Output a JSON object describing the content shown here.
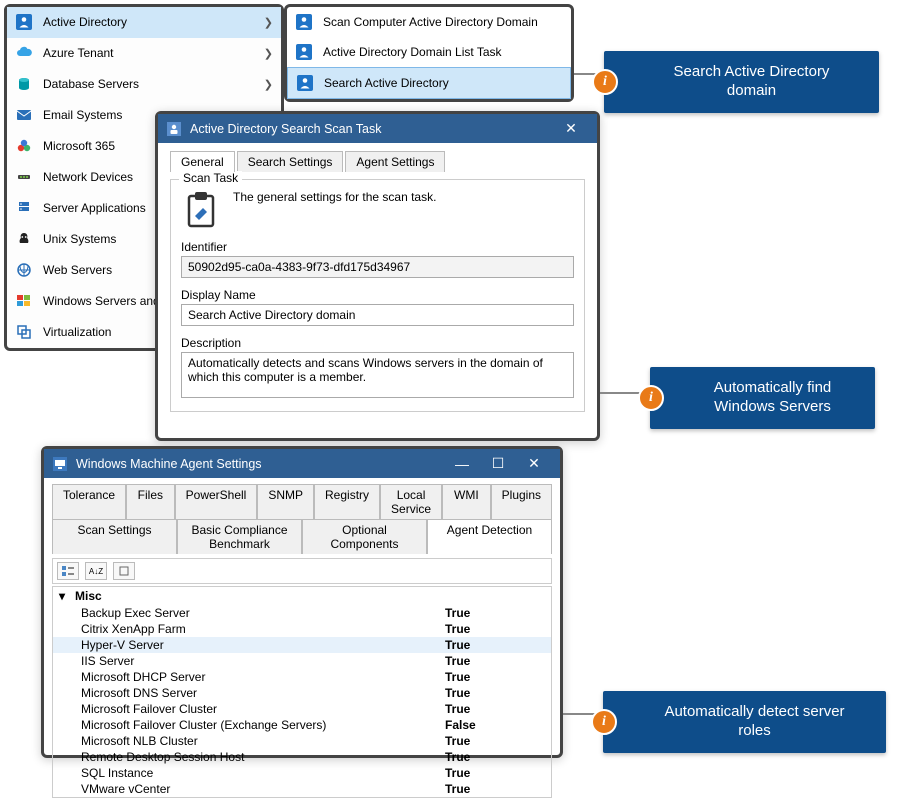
{
  "sidebar": {
    "items": [
      {
        "label": "Active Directory",
        "icon": "ad-icon",
        "chev": true,
        "selected": true
      },
      {
        "label": "Azure Tenant",
        "icon": "cloud-icon",
        "chev": true
      },
      {
        "label": "Database Servers",
        "icon": "db-icon",
        "chev": true
      },
      {
        "label": "Email Systems",
        "icon": "mail-icon"
      },
      {
        "label": "Microsoft 365",
        "icon": "m365-icon"
      },
      {
        "label": "Network Devices",
        "icon": "network-icon"
      },
      {
        "label": "Server Applications",
        "icon": "server-app-icon"
      },
      {
        "label": "Unix Systems",
        "icon": "unix-icon"
      },
      {
        "label": "Web Servers",
        "icon": "web-icon"
      },
      {
        "label": "Windows Servers and",
        "icon": "windows-icon"
      },
      {
        "label": "Virtualization",
        "icon": "virt-icon"
      }
    ]
  },
  "submenu": {
    "items": [
      {
        "label": "Scan Computer Active Directory Domain",
        "icon": "ad-icon"
      },
      {
        "label": "Active Directory Domain List Task",
        "icon": "ad-icon"
      },
      {
        "label": "Search Active Directory",
        "icon": "ad-icon",
        "selected": true
      }
    ]
  },
  "callouts": {
    "c1": "Search Active Directory domain",
    "c2_l1": "Automatically find",
    "c2_l2": "Windows Servers",
    "c3": "Automatically detect server roles",
    "badge": "i"
  },
  "dialog1": {
    "title": "Active Directory Search Scan Task",
    "tabs": [
      "General",
      "Search Settings",
      "Agent Settings"
    ],
    "group": "Scan Task",
    "group_desc": "The general settings for the scan task.",
    "id_label": "Identifier",
    "id_value": "50902d95-ca0a-4383-9f73-dfd175d34967",
    "name_label": "Display Name",
    "name_value": "Search Active Directory domain",
    "desc_label": "Description",
    "desc_value": "Automatically detects and scans Windows servers in the domain of which this computer is a member."
  },
  "dialog2": {
    "title": "Windows Machine Agent Settings",
    "tabs_row1": [
      "Tolerance",
      "Files",
      "PowerShell",
      "SNMP",
      "Registry",
      "Local Service",
      "WMI",
      "Plugins"
    ],
    "tabs_row2": [
      "Scan Settings",
      "Basic Compliance Benchmark",
      "Optional Components",
      "Agent Detection"
    ],
    "active_tab": "Agent Detection",
    "category": "Misc",
    "rows": [
      {
        "name": "Backup Exec Server",
        "value": "True"
      },
      {
        "name": "Citrix XenApp Farm",
        "value": "True"
      },
      {
        "name": "Hyper-V Server",
        "value": "True",
        "hl": true
      },
      {
        "name": "IIS Server",
        "value": "True"
      },
      {
        "name": "Microsoft DHCP Server",
        "value": "True"
      },
      {
        "name": "Microsoft DNS Server",
        "value": "True"
      },
      {
        "name": "Microsoft Failover Cluster",
        "value": "True"
      },
      {
        "name": "Microsoft Failover Cluster (Exchange Servers)",
        "value": "False"
      },
      {
        "name": "Microsoft NLB Cluster",
        "value": "True"
      },
      {
        "name": "Remote Desktop Session Host",
        "value": "True"
      },
      {
        "name": "SQL Instance",
        "value": "True"
      },
      {
        "name": "VMware vCenter",
        "value": "True"
      }
    ]
  }
}
